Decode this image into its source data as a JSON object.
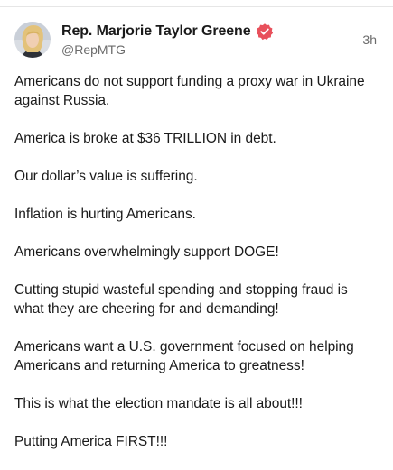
{
  "post": {
    "author": {
      "display_name": "Rep. Marjorie Taylor Greene",
      "handle": "@RepMTG",
      "verified_icon": "verified-badge-icon",
      "badge_color": "#e8505b"
    },
    "timestamp": "3h",
    "paragraphs": [
      "Americans do not support funding a proxy war in Ukraine against Russia.",
      "America is broke at $36 TRILLION in debt.",
      "Our dollar’s value is suffering.",
      "Inflation is hurting Americans.",
      "Americans overwhelmingly support DOGE!",
      "Cutting stupid wasteful spending and stopping fraud is what they are cheering for and demanding!",
      "Americans want a U.S. government focused on helping Americans and returning America to greatness!",
      "This is what the election mandate is all about!!!",
      "Putting America FIRST!!!"
    ]
  }
}
